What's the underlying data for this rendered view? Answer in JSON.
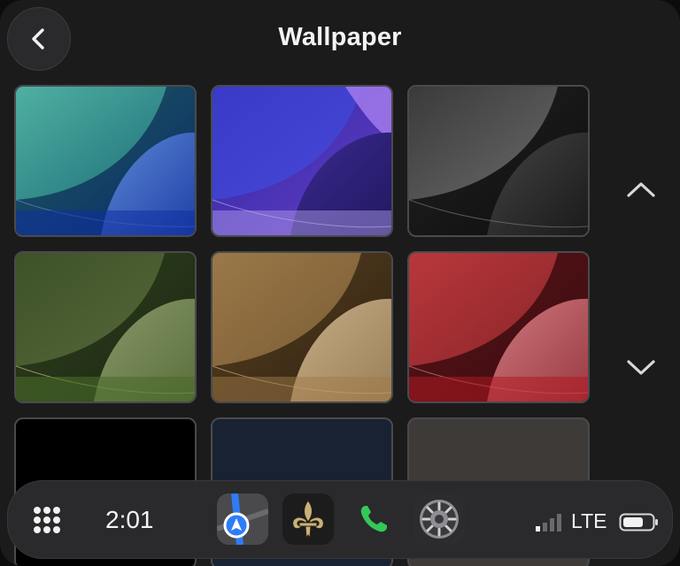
{
  "header": {
    "title": "Wallpaper"
  },
  "icons": {
    "back": "chevron-left-icon",
    "scroll_up": "chevron-up-icon",
    "scroll_down": "chevron-down-icon",
    "apps": "grid-icon",
    "maps": "maps-app-icon",
    "saints": "fleur-de-lis-app-icon",
    "phone": "phone-app-icon",
    "settings": "settings-app-icon",
    "signal": "signal-icon",
    "battery": "battery-icon"
  },
  "wallpapers": [
    {
      "name": "teal-blue",
      "selected": false
    },
    {
      "name": "purple-blue",
      "selected": false
    },
    {
      "name": "graphite",
      "selected": false
    },
    {
      "name": "olive-green",
      "selected": false
    },
    {
      "name": "sand-gold",
      "selected": false
    },
    {
      "name": "crimson",
      "selected": false
    },
    {
      "name": "black",
      "selected": false
    },
    {
      "name": "navy",
      "selected": false
    },
    {
      "name": "taupe",
      "selected": false
    }
  ],
  "dock": {
    "time": "2:01"
  },
  "status": {
    "network": "LTE",
    "signal_bars": 1,
    "signal_bars_total": 4
  },
  "colors": {
    "background": "#1b1b1c",
    "dock": "#2a2a2c",
    "phone_green": "#34c759",
    "maps_blue": "#2f7df6"
  }
}
